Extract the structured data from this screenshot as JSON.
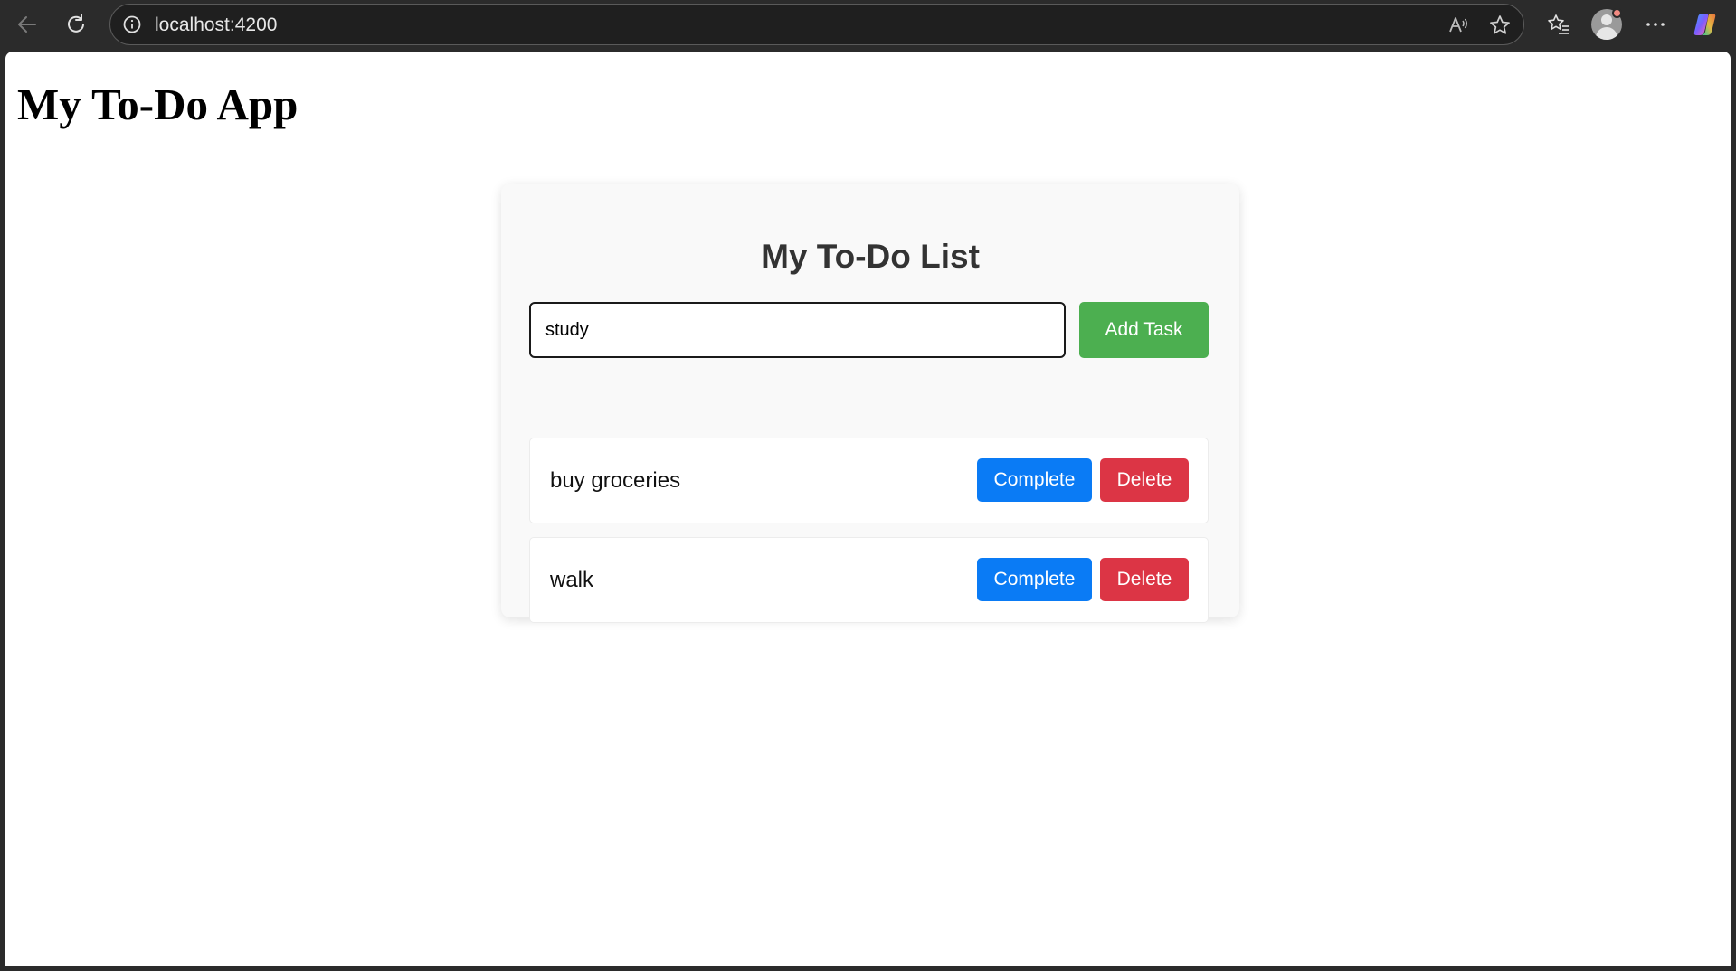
{
  "browser": {
    "url": "localhost:4200",
    "icons": {
      "back": "back-arrow-icon",
      "reload": "reload-icon",
      "info": "info-icon",
      "read_aloud": "read-aloud-icon",
      "favorite": "star-icon",
      "favorites_bar": "favorites-icon",
      "profile": "profile-avatar-icon",
      "more": "more-options-icon",
      "copilot": "copilot-icon"
    }
  },
  "page": {
    "heading": "My To-Do App"
  },
  "todo": {
    "title": "My To-Do List",
    "input_value": "study",
    "add_button_label": "Add Task",
    "tasks": [
      {
        "text": "buy groceries",
        "complete_label": "Complete",
        "delete_label": "Delete"
      },
      {
        "text": "walk",
        "complete_label": "Complete",
        "delete_label": "Delete"
      }
    ]
  },
  "colors": {
    "add_button": "#4caf50",
    "complete_button": "#0a7bf5",
    "delete_button": "#dc3545",
    "card_background": "#f9f9f9"
  }
}
